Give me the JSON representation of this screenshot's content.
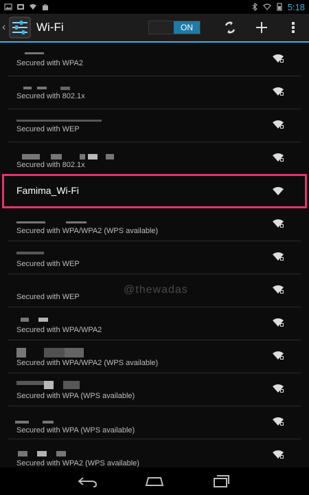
{
  "status_bar": {
    "time": "5:18",
    "left_icons": [
      "image-icon",
      "sim-icon",
      "wifi-download-icon",
      "bag-icon"
    ],
    "right_icons": [
      "bluetooth-icon",
      "signal-icon",
      "battery-icon"
    ]
  },
  "action_bar": {
    "title": "Wi-Fi",
    "toggle_label": "ON",
    "actions": [
      "scan-icon",
      "add-network-icon",
      "overflow-menu-icon"
    ]
  },
  "networks": [
    {
      "ssid": "",
      "security": "Secured with WPA2",
      "locked": true
    },
    {
      "ssid": "",
      "security": "Secured with 802.1x",
      "locked": true
    },
    {
      "ssid": "",
      "security": "Secured with WEP",
      "locked": true
    },
    {
      "ssid": "",
      "security": "Secured with 802.1x",
      "locked": true
    },
    {
      "ssid": "Famima_Wi-Fi",
      "security": "",
      "locked": false,
      "highlighted": true
    },
    {
      "ssid": "",
      "security": "Secured with WPA/WPA2 (WPS available)",
      "locked": true
    },
    {
      "ssid": "",
      "security": "Secured with WEP",
      "locked": true
    },
    {
      "ssid": "",
      "security": "Secured with WEP",
      "locked": true
    },
    {
      "ssid": "",
      "security": "Secured with WPA/WPA2",
      "locked": true
    },
    {
      "ssid": "",
      "security": "Secured with WPA/WPA2 (WPS available)",
      "locked": true
    },
    {
      "ssid": "",
      "security": "Secured with WPA (WPS available)",
      "locked": true
    },
    {
      "ssid": "",
      "security": "Secured with WPA (WPS available)",
      "locked": true
    },
    {
      "ssid": "",
      "security": "Secured with WPA2 (WPS available)",
      "locked": true
    }
  ],
  "watermark": "@thewadas",
  "nav_bar": {
    "buttons": [
      "back-icon",
      "home-icon",
      "recents-icon"
    ]
  },
  "colors": {
    "accent": "#33b5e5",
    "highlight": "#e8326a",
    "background": "#0c0c0c"
  }
}
